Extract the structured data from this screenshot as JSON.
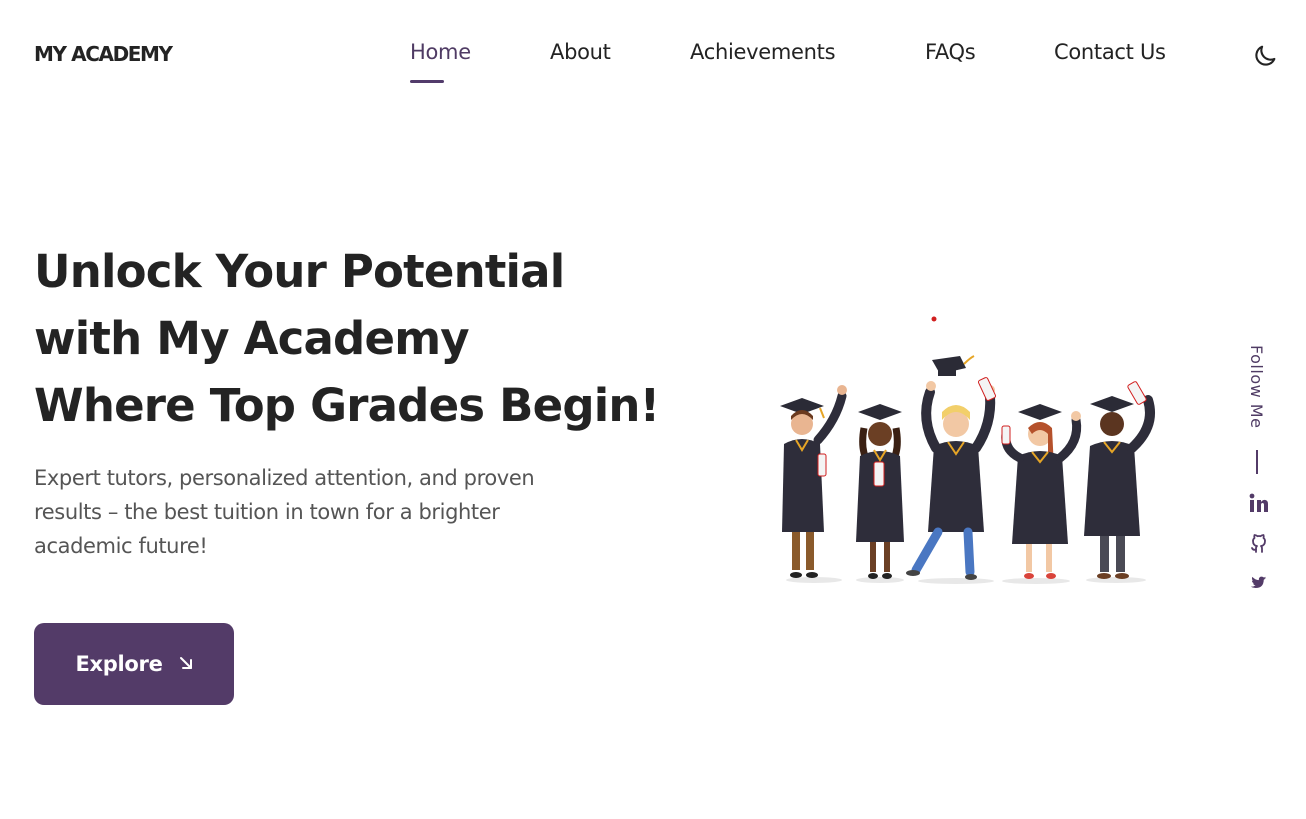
{
  "header": {
    "brand": "MY ACADEMY",
    "nav": {
      "home": "Home",
      "about": "About",
      "achievements": "Achievements",
      "faqs": "FAQs",
      "contact": "Contact Us"
    },
    "active_item": "Home",
    "theme_toggle_icon": "moon-icon"
  },
  "hero": {
    "title_line1": "Unlock Your Potential",
    "title_line2": "with My Academy",
    "title_line3": "Where Top Grades Begin!",
    "desc_line1": "Expert tutors, personalized attention, and proven",
    "desc_line2": "results – the best tuition in town for a brighter",
    "desc_line3": "academic future!",
    "button_label": "Explore",
    "button_icon": "arrow-down-right-icon"
  },
  "social": {
    "label": "Follow Me",
    "icons": [
      "linkedin-icon",
      "github-icon",
      "twitter-icon"
    ]
  },
  "colors": {
    "accent": "#533b68",
    "text": "#232323",
    "muted": "#555555",
    "background": "#ffffff"
  }
}
